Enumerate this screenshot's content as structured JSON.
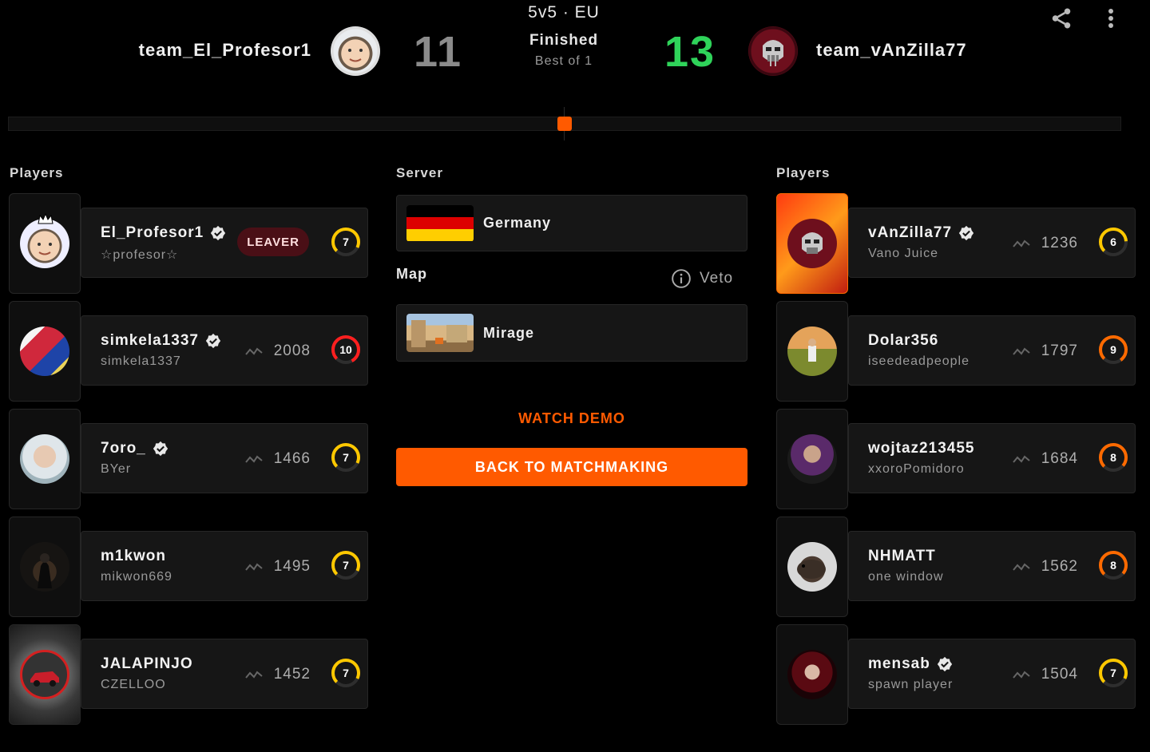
{
  "header": {
    "mode": "5v5 · EU",
    "status": "Finished",
    "best_of": "Best of 1",
    "left_team": {
      "name": "team_El_Profesor1",
      "score": "11"
    },
    "right_team": {
      "name": "team_vAnZilla77",
      "score": "13"
    },
    "share_icon": "share-icon",
    "menu_icon": "more-vertical-icon"
  },
  "colors": {
    "accent": "#ff5a00",
    "win": "#2fd35a",
    "lose": "#8b8b8b",
    "leaver_bg": "#4a0f16"
  },
  "left": {
    "title": "Players",
    "players": [
      {
        "name": "El_Profesor1",
        "nick": "☆profesor☆",
        "verified": true,
        "badge": "LEAVER",
        "elo": "",
        "level": "7"
      },
      {
        "name": "simkela1337",
        "nick": "simkela1337",
        "verified": true,
        "elo": "2008",
        "level": "10"
      },
      {
        "name": "7oro_",
        "nick": "BYer",
        "verified": true,
        "elo": "1466",
        "level": "7"
      },
      {
        "name": "m1kwon",
        "nick": "mikwon669",
        "verified": false,
        "elo": "1495",
        "level": "7"
      },
      {
        "name": "JALAPINJO",
        "nick": "CZELLOO",
        "verified": false,
        "elo": "1452",
        "level": "7"
      }
    ]
  },
  "center": {
    "server_label": "Server",
    "server": "Germany",
    "map_label": "Map",
    "veto_label": "Veto",
    "map": "Mirage",
    "watch_demo": "WATCH DEMO",
    "back_button": "BACK TO MATCHMAKING"
  },
  "right": {
    "title": "Players",
    "players": [
      {
        "name": "vAnZilla77",
        "nick": "Vano Juice",
        "verified": true,
        "elo": "1236",
        "level": "6"
      },
      {
        "name": "Dolar356",
        "nick": "iseedeadpeople",
        "verified": false,
        "elo": "1797",
        "level": "9"
      },
      {
        "name": "wojtaz213455",
        "nick": "xxoroPomidoro",
        "verified": false,
        "elo": "1684",
        "level": "8"
      },
      {
        "name": "NHMATT",
        "nick": "one window",
        "verified": false,
        "elo": "1562",
        "level": "8"
      },
      {
        "name": "mensab",
        "nick": "spawn player",
        "verified": true,
        "elo": "1504",
        "level": "7"
      }
    ]
  }
}
